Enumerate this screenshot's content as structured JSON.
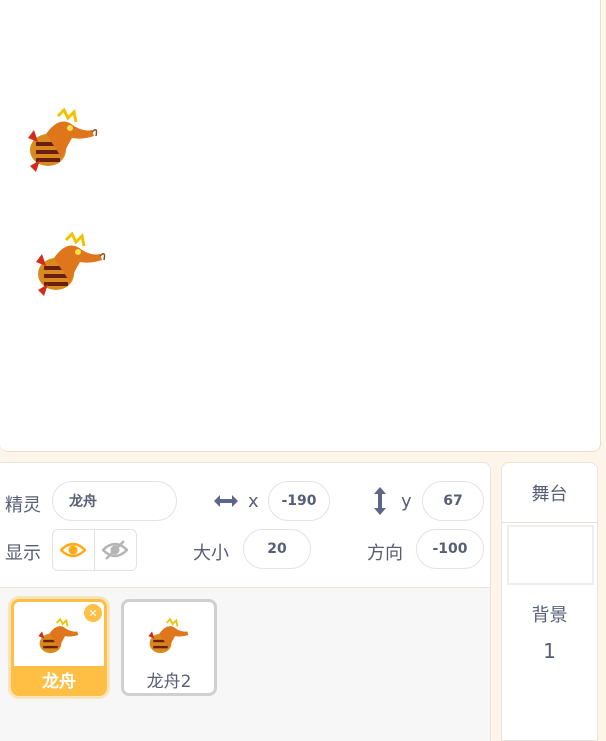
{
  "sprite_info": {
    "sprite_label": "精灵",
    "sprite_name": "龙舟",
    "x_label": "x",
    "x_value": "-190",
    "y_label": "y",
    "y_value": "67",
    "show_label": "显示",
    "size_label": "大小",
    "size_value": "20",
    "direction_label": "方向",
    "direction_value": "-100"
  },
  "sprites": [
    {
      "name": "龙舟",
      "selected": true
    },
    {
      "name": "龙舟2",
      "selected": false
    }
  ],
  "stage_panel": {
    "title": "舞台",
    "backdrop_label": "背景",
    "backdrop_count": "1"
  },
  "colors": {
    "accent": "#ffbf44",
    "text": "#575e75",
    "eye_active": "#ffab19"
  }
}
